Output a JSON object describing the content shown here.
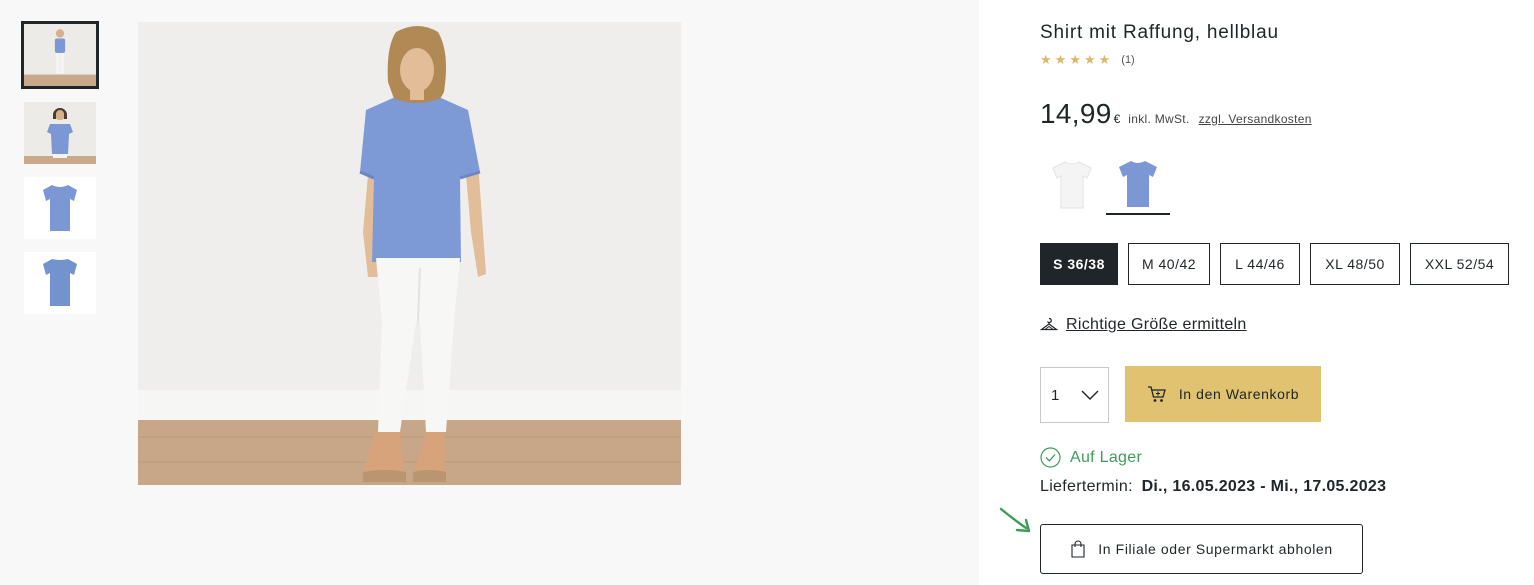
{
  "product": {
    "title": "Shirt mit Raffung, hellblau",
    "rating": {
      "stars": 5,
      "count_label": "(1)"
    },
    "price": {
      "amount": "14,99",
      "currency": "€",
      "vat_note": "inkl. MwSt.",
      "shipping_link": "zzgl. Versandkosten"
    }
  },
  "gallery": {
    "thumbnails": [
      {
        "icon": "model-full-body-thumbnail",
        "selected": true
      },
      {
        "icon": "model-upper-body-thumbnail",
        "selected": false
      },
      {
        "icon": "shirt-front-thumbnail",
        "selected": false
      },
      {
        "icon": "shirt-back-thumbnail",
        "selected": false
      }
    ],
    "main_image": "model-wearing-light-blue-shirt-photo"
  },
  "colors": [
    {
      "name": "white-shirt-swatch",
      "color": "#f4f4f4",
      "selected": false
    },
    {
      "name": "blue-shirt-swatch",
      "color": "#7b97d4",
      "selected": true
    }
  ],
  "sizes": [
    {
      "label": "S 36/38",
      "selected": true
    },
    {
      "label": "M 40/42",
      "selected": false
    },
    {
      "label": "L 44/46",
      "selected": false
    },
    {
      "label": "XL 48/50",
      "selected": false
    },
    {
      "label": "XXL 52/54",
      "selected": false
    }
  ],
  "size_finder": {
    "label": "Richtige Größe ermitteln",
    "icon": "hanger-icon"
  },
  "quantity": {
    "value": "1",
    "icon": "chevron-down-icon"
  },
  "cart_button": {
    "label": "In den Warenkorb",
    "icon": "cart-icon"
  },
  "stock": {
    "label": "Auf Lager",
    "icon": "check-circle-icon"
  },
  "delivery": {
    "label": "Liefertermin:",
    "date": "Di., 16.05.2023 - Mi., 17.05.2023"
  },
  "pickup_button": {
    "label": "In Filiale oder Supermarkt abholen",
    "icon": "shopping-bag-icon"
  },
  "colors_theme": {
    "accent": "#e0c270",
    "dark": "#1f2529",
    "success": "#3f9b5a",
    "star": "#d9b96a"
  }
}
